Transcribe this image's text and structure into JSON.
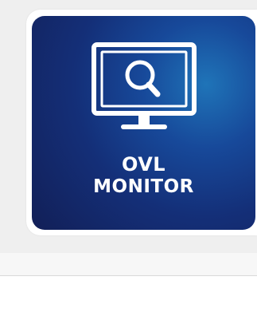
{
  "tile": {
    "line1": "OVL",
    "line2": "MONITOR",
    "icon": "monitor-search-icon",
    "colors": {
      "background_dark": "#121f57",
      "background_mid": "#142f78",
      "highlight": "#1f74b8",
      "foreground": "#ffffff"
    }
  }
}
